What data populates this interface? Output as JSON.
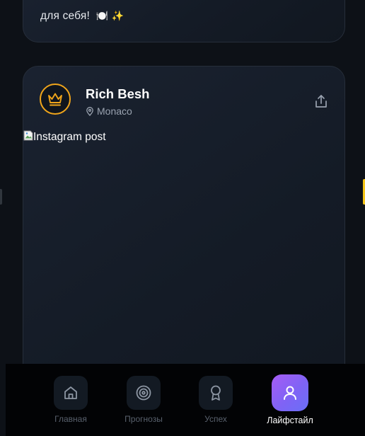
{
  "feed": {
    "top_card": {
      "text": "для себя!",
      "emoji": "🍽️ ✨"
    },
    "post": {
      "author_name": "Rich Besh",
      "location": "Monaco",
      "image_alt": "Instagram post",
      "avatar_icon": "crown-icon",
      "share_icon": "share-icon",
      "accent_color": "#f0a51b"
    }
  },
  "nav": {
    "items": [
      {
        "label": "Главная",
        "icon": "home-icon",
        "active": false
      },
      {
        "label": "Прогнозы",
        "icon": "target-icon",
        "active": false
      },
      {
        "label": "Успех",
        "icon": "award-icon",
        "active": false
      },
      {
        "label": "Лайфстайл",
        "icon": "user-icon",
        "active": true
      }
    ],
    "active_color": "#8b5cf6"
  }
}
